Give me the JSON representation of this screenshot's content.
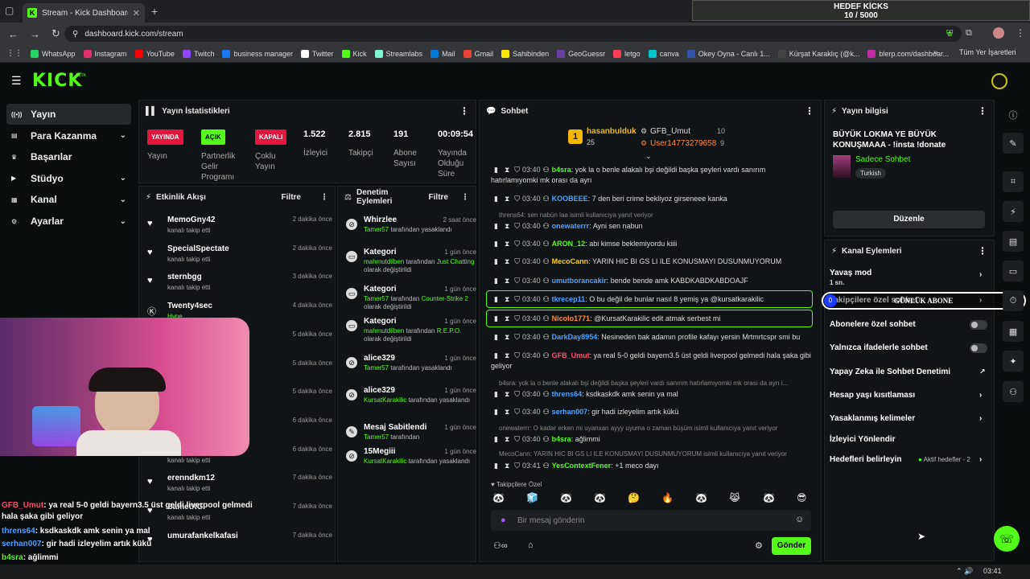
{
  "browser": {
    "tab_title": "Stream - Kick Dashboard",
    "url": "dashboard.kick.com/stream",
    "bookmarks": [
      {
        "label": "WhatsApp",
        "color": "#25d366"
      },
      {
        "label": "Instagram",
        "color": "#e1306c"
      },
      {
        "label": "YouTube",
        "color": "#ff0000"
      },
      {
        "label": "Twitch",
        "color": "#9146ff"
      },
      {
        "label": "business manager",
        "color": "#1877f2"
      },
      {
        "label": "Twitter",
        "color": "#ffffff"
      },
      {
        "label": "Kick",
        "color": "#53fc18"
      },
      {
        "label": "Streamlabs",
        "color": "#80f5d2"
      },
      {
        "label": "Mail",
        "color": "#0078d4"
      },
      {
        "label": "Gmail",
        "color": "#ea4335"
      },
      {
        "label": "Sahibinden",
        "color": "#ffe800"
      },
      {
        "label": "GeoGuessr",
        "color": "#6b3fa0"
      },
      {
        "label": "letgo",
        "color": "#ff3f55"
      },
      {
        "label": "canva",
        "color": "#00c4cc"
      },
      {
        "label": "Okey Oyna - Canlı 1...",
        "color": "#3355aa"
      },
      {
        "label": "Kürşat Karaklıç (@k...",
        "color": "#444444"
      },
      {
        "label": "blerp.com/dashboar...",
        "color": "#c22ba6"
      }
    ],
    "all_bookmarks": "Tüm Yer İşaretleri"
  },
  "hedef": {
    "title": "HEDEF KİCKS",
    "value": "10 / 5000"
  },
  "logo": "KICK",
  "logo_beta": "BETA",
  "sidebar": [
    {
      "label": "Yayın",
      "icon": "broadcast-icon",
      "chev": ""
    },
    {
      "label": "Para Kazanma",
      "icon": "wallet-icon",
      "chev": "⌄"
    },
    {
      "label": "Başarılar",
      "icon": "trophy-icon",
      "chev": ""
    },
    {
      "label": "Stüdyo",
      "icon": "studio-icon",
      "chev": "⌄"
    },
    {
      "label": "Kanal",
      "icon": "channel-icon",
      "chev": "⌄"
    },
    {
      "label": "Ayarlar",
      "icon": "gear-icon",
      "chev": "⌄"
    }
  ],
  "stats": {
    "title": "Yayın İstatistikleri",
    "items": [
      {
        "badge": "YAYINDA",
        "badge_color": "#e3173e",
        "label": "Yayın"
      },
      {
        "badge": "AÇIK",
        "badge_color": "#53fc18",
        "label": "Partnerlik Gelir Programı"
      },
      {
        "badge": "KAPALI",
        "badge_color": "#e3173e",
        "label": "Çoklu Yayın"
      },
      {
        "num": "1.522",
        "label": "İzleyici"
      },
      {
        "num": "2.815",
        "label": "Takipçi"
      },
      {
        "num": "191",
        "label": "Abone Sayısı"
      },
      {
        "num": "00:09:54",
        "label": "Yayında Olduğu Süre"
      }
    ]
  },
  "activity": {
    "title": "Etkinlik Akışı",
    "filter": "Filtre",
    "items": [
      {
        "name": "MemoGny42",
        "sub": "kanalı takip etti",
        "time": "2 dakika önce"
      },
      {
        "name": "SpecialSpectate",
        "sub": "kanalı takip etti",
        "time": "2 dakika önce"
      },
      {
        "name": "sternbgg",
        "sub": "kanalı takip etti",
        "time": "3 dakika önce"
      },
      {
        "name": "Twenty4sec",
        "sub": "Hype",
        "time": "4 dakika önce"
      },
      {
        "name": "",
        "sub": "",
        "time": "5 dakika önce"
      },
      {
        "name": "",
        "sub": "",
        "time": "5 dakika önce"
      },
      {
        "name": "",
        "sub": "",
        "time": "5 dakika önce"
      },
      {
        "name": "",
        "sub": "",
        "time": "6 dakika önce"
      },
      {
        "name": "onurreis_35",
        "sub": "kanalı takip etti",
        "time": "6 dakika önce"
      },
      {
        "name": "erenndkm12",
        "sub": "kanalı takip etti",
        "time": "7 dakika önce"
      },
      {
        "name": "SametXG",
        "sub": "kanalı takip etti",
        "time": "7 dakika önce"
      },
      {
        "name": "umurafankelkafasi",
        "sub": "",
        "time": "7 dakika önce"
      }
    ]
  },
  "moderation": {
    "title": "Denetim Eylemleri",
    "filter": "Filtre",
    "items": [
      {
        "name": "Whirzlee",
        "by": "Tamer57",
        "rest": " tarafından yasaklandı",
        "extra": "",
        "time": "2 saat önce"
      },
      {
        "name": "Kategori",
        "by": "mahmutdilben",
        "rest": " tarafından ",
        "extra": "Just Chatting",
        "rest2": " olarak değiştirildi",
        "time": "1 gün önce"
      },
      {
        "name": "Kategori",
        "by": "Tamer57",
        "rest": " tarafından ",
        "extra": "Counter-Strike 2",
        "rest2": " olarak değiştirildi",
        "time": "1 gün önce"
      },
      {
        "name": "Kategori",
        "by": "mahmutdilben",
        "rest": " tarafından ",
        "extra": "R.E.P.O.",
        "rest2": " olarak değiştirildi",
        "time": "1 gün önce"
      },
      {
        "name": "alice329",
        "by": "Tamer57",
        "rest": " tarafından yasaklandı",
        "extra": "",
        "time": "1 gün önce"
      },
      {
        "name": "alice329",
        "by": "KursatKarakilic",
        "rest": " tarafından yasaklandı",
        "extra": "",
        "time": "1 gün önce"
      },
      {
        "name": "Mesaj Sabitlendi",
        "by": "Tamer57",
        "rest": " tarafından",
        "extra": "",
        "time": "1 gün önce"
      },
      {
        "name": "15Megiii",
        "by": "KursatKarakilic",
        "rest": " tarafından yasaklandı",
        "extra": "",
        "time": "1 gün önce"
      }
    ]
  },
  "chat": {
    "title": "Sohbet",
    "top1": {
      "name": "hasanbulduk",
      "count": "25"
    },
    "top2": {
      "name": "GFB_Umut",
      "count": "10"
    },
    "top3": {
      "name": "User14773279658",
      "count": "9"
    },
    "messages": [
      {
        "time": "03:40",
        "user": "b4sra",
        "color": "#53fc18",
        "text": "yok la o benle alakalı bşi değildi başka şeyleri vardı sanırım hatırlamıyomki mk orası da ayrı"
      },
      {
        "time": "03:40",
        "user": "KOOBEEE",
        "color": "#4da3ff",
        "text": "7 den beri crime bekliyoz girseneee kanka"
      },
      {
        "time": "03:40",
        "user": "onewaterrr",
        "color": "#4da3ff",
        "text": "Ayni sen nabun"
      },
      {
        "time": "03:40",
        "user": "ARON_12",
        "color": "#53fc18",
        "text": "abi kimse beklemiyordu kiiii"
      },
      {
        "time": "03:40",
        "user": "MecoCann",
        "color": "#ffcc00",
        "text": "YARIN HIC BI GS LI ILE KONUSMAYI DUSUNMUYORUM"
      },
      {
        "time": "03:40",
        "user": "umutborancakir",
        "color": "#4da3ff",
        "text": "bende bende amk KABDKABDKABDOAJF"
      },
      {
        "time": "03:40",
        "user": "tkrecep11",
        "color": "#4da3ff",
        "text": "O bu değil de bunlar nasıl 8 yemiş ya @kursatkarakilic"
      },
      {
        "time": "03:40",
        "user": "Nicolo1771",
        "color": "#ff8a3d",
        "text": "@KursatKarakilic edit atmak serbest mi"
      },
      {
        "time": "03:40",
        "user": "DarkDay8954",
        "color": "#4da3ff",
        "text": "Nesineden bak adamın profile kafayı yersin Mrtmrtcspr smi bu"
      },
      {
        "time": "03:40",
        "user": "GFB_Umut",
        "color": "#ff4d6d",
        "text": "ya real 5-0 geldi bayern3.5 üst geldi liverpool gelmedi hala şaka gibi geliyor"
      },
      {
        "time": "03:40",
        "user": "threns64",
        "color": "#4da3ff",
        "text": "ksdkaskdk amk senin ya mal"
      },
      {
        "time": "03:40",
        "user": "serhan007",
        "color": "#4da3ff",
        "text": "gir hadi izleyelim artık kükü"
      },
      {
        "time": "03:40",
        "user": "b4sra",
        "color": "#53fc18",
        "text": "ağlimmi"
      },
      {
        "time": "03:41",
        "user": "YesContextFener",
        "color": "#53fc18",
        "text": "+1 meco dayı"
      }
    ],
    "replies": [
      "threns64: sen nabün laa isimli kullanıcıya yanıt veriyor",
      "b4sra: yok la o benle alakalı bşi değildi başka şeyleri vardı sanırım hatırlamıyomki mk orası da ayrı i...",
      "onewaterrr: O kadar erken mi uyanxan ayyy uyuma o zaman büşüm isimli kullanıcıya yanıt veriyor",
      "MecoCann: YARIN HIC BI GS LI ILE KONUSMAYI DUSUNMUYORUM isimli kullanıcıya yanıt veriyor"
    ],
    "emote_label": "Takipçilere Özel",
    "input_placeholder": "Bir mesaj gönderin",
    "send": "Gönder"
  },
  "info": {
    "title": "Yayın bilgisi",
    "stream_title": "BÜYÜK LOKMA YE BÜYÜK KONUŞMAAA - !insta !donate",
    "category": "Sadece Sohbet",
    "language": "Turkish",
    "edit": "Düzenle"
  },
  "channel_actions": {
    "title": "Kanal Eylemleri",
    "slow_mode": "Yavaş mod",
    "slow_mode_val": "1 sn.",
    "followers_only": "Takipçilere özel sohbet",
    "sub_only": "Abonelere özel sohbet",
    "emote_only": "Yalnızca ifadelerle sohbet",
    "ai_mod": "Yapay Zeka ile Sohbet Denetimi",
    "age": "Hesap yaşı kısıtlaması",
    "banned_words": "Yasaklanmış kelimeler",
    "redirect": "İzleyici Yönlendir",
    "goals": "Hedefleri belirleyin",
    "goals_status": "Aktif hedefler - 2"
  },
  "overlay_sub": {
    "count": "0",
    "label": "GÜNLÜK ABONE",
    "goal": "10"
  },
  "overlay_chat": [
    {
      "user": "GFB_Umut",
      "color": "#ff4d6d",
      "text": ": ya real 5-0 geldi bayern3.5 üst geldi liverpool gelmedi"
    },
    {
      "user": "",
      "color": "#fff",
      "text": "hala şaka gibi geliyor"
    },
    {
      "user": "threns64",
      "color": "#4da3ff",
      "text": ": ksdkaskdk amk senin ya mal"
    },
    {
      "user": "serhan007",
      "color": "#4da3ff",
      "text": ": gir hadi izleyelim artık kükü"
    },
    {
      "user": "b4sra",
      "color": "#53fc18",
      "text": ": ağlimmi"
    },
    {
      "user": "YesContextFener",
      "color": "#53fc18",
      "text": ": +1 meco dayı"
    }
  ],
  "clock": "03:41"
}
